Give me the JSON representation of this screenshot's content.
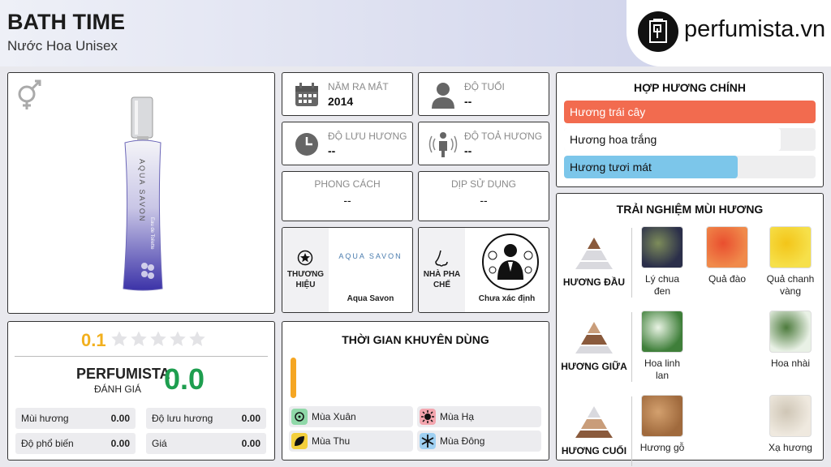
{
  "header": {
    "title": "BATH TIME",
    "subtitle": "Nước Hoa Unisex",
    "logo_text": "perfumista.vn"
  },
  "product": {
    "gender_icon": "unisex-icon",
    "bottle_brand_text": "AQUA SAVON",
    "bottle_sub_text": "Eau de Toilette"
  },
  "rating": {
    "score": "0.1",
    "stars_filled": 0,
    "stars_total": 5,
    "perfumista_label": "PERFUMISTA",
    "review_label": "ĐÁNH GIÁ",
    "perfumista_score": "0.0",
    "stats": [
      {
        "label": "Mùi hương",
        "value": "0.00"
      },
      {
        "label": "Độ lưu hương",
        "value": "0.00"
      },
      {
        "label": "Độ phổ biến",
        "value": "0.00"
      },
      {
        "label": "Giá",
        "value": "0.00"
      }
    ]
  },
  "info": {
    "year_label": "NĂM RA MẮT",
    "year_value": "2014",
    "age_label": "ĐỘ TUỔI",
    "age_value": "--",
    "longevity_label": "ĐỘ LƯU HƯƠNG",
    "longevity_value": "--",
    "sillage_label": "ĐỘ TOẢ HƯƠNG",
    "sillage_value": "--",
    "style_label": "PHONG CÁCH",
    "style_value": "--",
    "occasion_label": "DỊP SỬ DỤNG",
    "occasion_value": "--",
    "brand_label": "THƯƠNG HIỆU",
    "brand_name": "Aqua Savon",
    "brand_logo_text": "AQUA SAVON",
    "perfumer_label": "NHÀ PHA CHẾ",
    "perfumer_name": "Chưa xác định"
  },
  "accords": {
    "title": "HỢP HƯƠNG CHÍNH",
    "items": [
      {
        "label": "Hương trái cây",
        "fraction": 1.0,
        "color": "#f26b4f",
        "text_color": "#ffffff"
      },
      {
        "label": "Hương hoa trắng",
        "fraction": 0.86,
        "color": "#ffffff",
        "text_color": "#111111"
      },
      {
        "label": "Hương tươi mát",
        "fraction": 0.69,
        "color": "#7cc6ea",
        "text_color": "#111111"
      }
    ]
  },
  "experience": {
    "title": "TRẢI NGHIỆM MÙI HƯƠNG",
    "tiers": [
      {
        "label": "HƯƠNG ĐẦU",
        "notes": [
          "Lý chua đen",
          "Quả đào",
          "Quả chanh vàng"
        ]
      },
      {
        "label": "HƯƠNG GIỮA",
        "notes": [
          "Hoa linh lan",
          "Hoa nhài"
        ]
      },
      {
        "label": "HƯƠNG CUỐI",
        "notes": [
          "Hương gỗ",
          "Xạ hương"
        ]
      }
    ]
  },
  "seasons": {
    "title": "THỜI GIAN KHUYÊN DÙNG",
    "items": [
      {
        "label": "Mùa Xuân",
        "color": "#8fd8a8"
      },
      {
        "label": "Mùa Hạ",
        "color": "#f3a5ae"
      },
      {
        "label": "Mùa Thu",
        "color": "#f3cf3c"
      },
      {
        "label": "Mùa Đông",
        "color": "#9fd0f2"
      }
    ]
  },
  "colors": {
    "score_yellow": "#f2b01e",
    "score_green": "#1e9e4f",
    "time_bar": "#f5a623"
  }
}
